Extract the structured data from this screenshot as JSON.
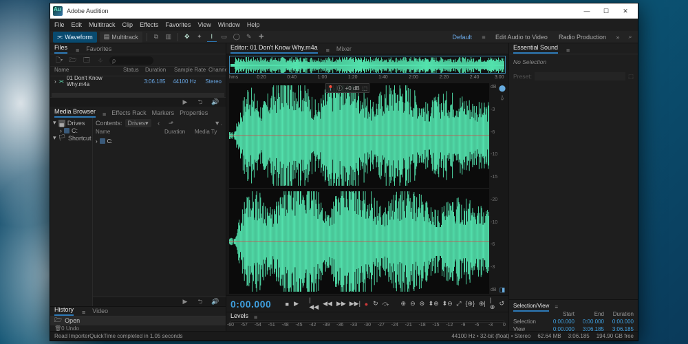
{
  "app": {
    "title": "Adobe Audition"
  },
  "menu": [
    "File",
    "Edit",
    "Multitrack",
    "Clip",
    "Effects",
    "Favorites",
    "View",
    "Window",
    "Help"
  ],
  "modes": {
    "waveform": "Waveform",
    "multitrack": "Multitrack"
  },
  "workspaces": {
    "default": "Default",
    "edit_audio_to_video": "Edit Audio to Video",
    "radio": "Radio Production"
  },
  "files_panel": {
    "tabs": [
      "Files",
      "Favorites"
    ],
    "columns": [
      "Name",
      "Status",
      "Duration",
      "Sample Rate",
      "Channels"
    ],
    "rows": [
      {
        "name": "01 Don't Know Why.m4a",
        "status": "",
        "duration": "3:06.185",
        "sample_rate": "44100 Hz",
        "channels": "Stereo"
      }
    ],
    "search_placeholder": "ρ"
  },
  "media_browser": {
    "tabs": [
      "Media Browser",
      "Effects Rack",
      "Markers",
      "Properties"
    ],
    "contents_label": "Contents:",
    "drives_label": "Drives",
    "columns": [
      "Name",
      "Duration",
      "Media Ty"
    ],
    "tree": [
      "Drives",
      "C:",
      "Shortcut"
    ],
    "rows": [
      {
        "name": "C:"
      }
    ]
  },
  "history": {
    "tabs": [
      "History",
      "Video"
    ],
    "items": [
      "Open"
    ],
    "undo_label": "0 Undo"
  },
  "editor": {
    "tabs_prefix": "Editor:",
    "file": "01 Don't Know Why.m4a",
    "other_tab": "Mixer",
    "ruler": [
      "hms",
      "0:20",
      "0:40",
      "1:00",
      "1:20",
      "1:40",
      "2:00",
      "2:20",
      "2:40",
      "3:00"
    ],
    "db_scale": [
      "dB",
      "-3",
      "-6",
      "-10",
      "-15",
      "-20",
      "-10",
      "-6",
      "-3",
      "dB"
    ],
    "hud_db": "dB",
    "timecode": "0:00.000"
  },
  "levels": {
    "label": "Levels",
    "ticks": [
      "-60",
      "-57",
      "-54",
      "-51",
      "-48",
      "-45",
      "-42",
      "-39",
      "-36",
      "-33",
      "-30",
      "-27",
      "-24",
      "-21",
      "-18",
      "-15",
      "-12",
      "-9",
      "-6",
      "-3",
      "0"
    ]
  },
  "essential_sound": {
    "title": "Essential Sound",
    "no_selection": "No Selection",
    "preset_label": "Preset:"
  },
  "selection_view": {
    "title": "Selection/View",
    "headers": [
      "Start",
      "End",
      "Duration"
    ],
    "selection_label": "Selection",
    "view_label": "View",
    "selection": [
      "0:00.000",
      "0:00.000",
      "0:00.000"
    ],
    "view": [
      "0:00.000",
      "3:06.185",
      "3:06.185"
    ]
  },
  "status": {
    "task": "Read ImporterQuickTime completed in 1.05 seconds",
    "format": "44100 Hz • 32-bit (float) • Stereo",
    "size": "62.64 MB",
    "duration": "3:06.185",
    "disk": "194.90 GB free"
  },
  "icons": {
    "search": "⌕",
    "play": "▶",
    "stop": "■",
    "record": "●",
    "loop": "↻",
    "prev": "|◀◀",
    "rew": "◀◀",
    "fwd": "▶▶",
    "next": "▶▶|",
    "skip": "⤼",
    "zoom_in": "⊕",
    "zoom_out": "⊖",
    "zoom_full": "⤢",
    "volume": "🔊",
    "folder": "🗀"
  }
}
